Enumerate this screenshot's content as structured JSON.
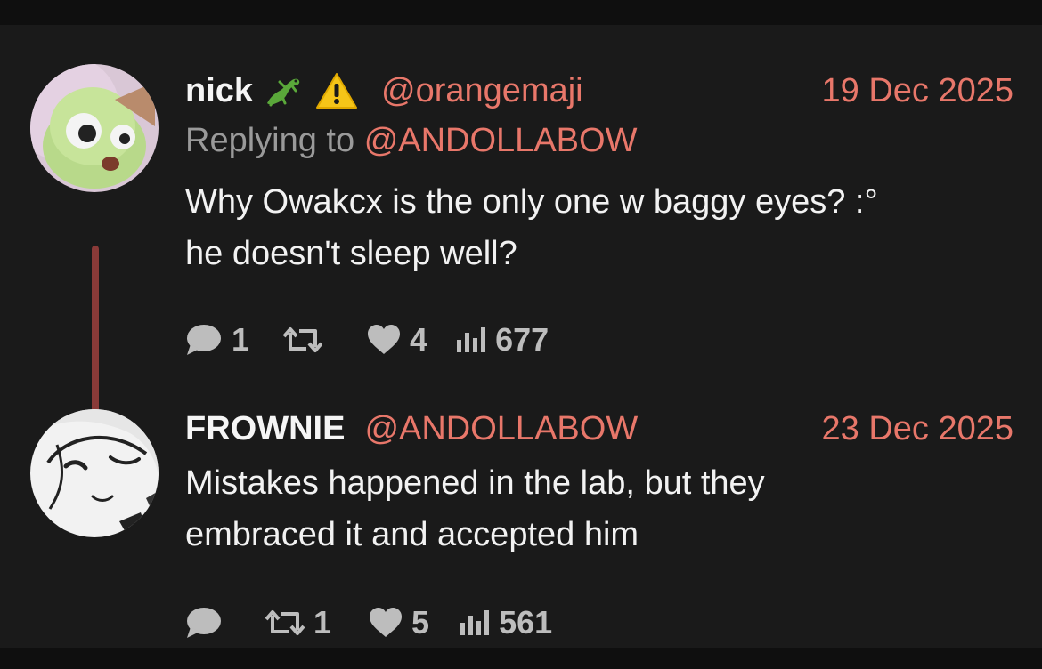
{
  "colors": {
    "background": "#1a1a1a",
    "accent": "#e8776a",
    "thread_line": "#8a3a38",
    "muted": "#9a9a9a",
    "icon": "#bdbdbd"
  },
  "posts": [
    {
      "display_name": "nick",
      "badges": [
        "lizard-emoji",
        "warning-emoji"
      ],
      "handle": "@orangemaji",
      "date": "19 Dec 2025",
      "replying_prefix": "Replying to",
      "replying_handle": "@ANDOLLABOW",
      "text_line1": "Why Owakcx is the only one w baggy eyes? :°",
      "text_line2": "he doesn't sleep well?",
      "replies": "1",
      "reposts": "",
      "likes": "4",
      "views": "677"
    },
    {
      "display_name": "FROWNIE",
      "handle": "@ANDOLLABOW",
      "date": "23 Dec 2025",
      "text_line1": "Mistakes happened in the lab, but they",
      "text_line2": "embraced it and accepted him",
      "replies": "",
      "reposts": "1",
      "likes": "5",
      "views": "561"
    }
  ]
}
